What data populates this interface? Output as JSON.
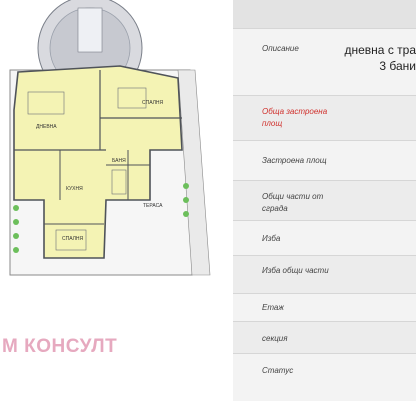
{
  "brand": {
    "text": "М КОНСУЛТ"
  },
  "floor_plan": {
    "rooms": [
      {
        "label": "ДНЕВНА"
      },
      {
        "label": "СПАЛНЯ"
      },
      {
        "label": "КУХНЯ"
      },
      {
        "label": "ТЕРАСА"
      },
      {
        "label": "БАНЯ"
      },
      {
        "label": "СПАЛНЯ"
      }
    ]
  },
  "details": {
    "rows": [
      {
        "label": "Описание",
        "value_line1": "дневна с тра",
        "value_line2": "3 бани"
      },
      {
        "label": "Обща застроена площ",
        "value_line1": "",
        "value_line2": ""
      },
      {
        "label": "Застроена площ",
        "value_line1": "",
        "value_line2": ""
      },
      {
        "label": "Общи части от сграда",
        "value_line1": "",
        "value_line2": ""
      },
      {
        "label": "Изба",
        "value_line1": "",
        "value_line2": ""
      },
      {
        "label": "Изба общи части",
        "value_line1": "",
        "value_line2": ""
      },
      {
        "label": "Етаж",
        "value_line1": "",
        "value_line2": ""
      },
      {
        "label": "секция",
        "value_line1": "",
        "value_line2": ""
      },
      {
        "label": "Статус",
        "value_line1": "",
        "value_line2": ""
      }
    ]
  },
  "colors": {
    "accent_red": "#d0312d",
    "brand_pink": "#e6a9bf",
    "plan_fill": "#f4f3b4"
  }
}
